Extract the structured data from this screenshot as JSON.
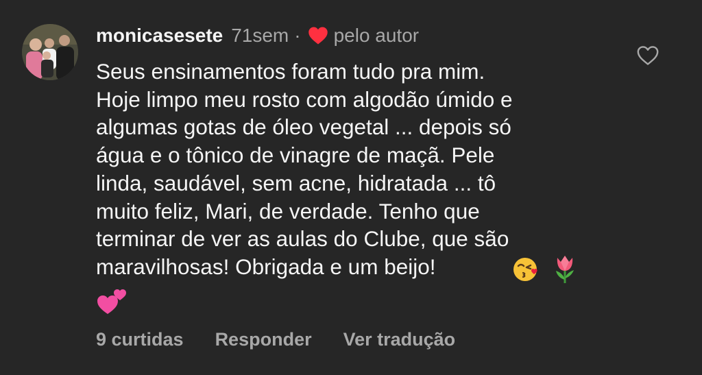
{
  "comment": {
    "username": "monicasesete",
    "time_ago": "71sem",
    "separator": "·",
    "author_badge": "pelo autor",
    "text": "Seus ensinamentos foram tudo pra mim.\nHoje limpo meu rosto com algodão úmido e\nalgumas gotas de óleo vegetal ... depois só\nágua e o tônico de vinagre de maçã. Pele\nlinda, saudável,  sem acne, hidratada ... tô\nmuito feliz, Mari, de verdade. Tenho que\nterminar de ver as aulas do Clube, que são\nmaravilhosas! Obrigada e um beijo!",
    "emojis": [
      "kissing-face-with-heart",
      "tulip",
      "two-hearts"
    ]
  },
  "footer": {
    "likes": "9 curtidas",
    "reply": "Responder",
    "translate": "Ver tradução"
  },
  "icons": {
    "like": "heart-outline-icon",
    "author_heart": "heart-filled-icon"
  },
  "colors": {
    "background": "#262626",
    "text": "#f5f5f5",
    "secondary": "#a8a8a8",
    "heart": "#ff3040"
  }
}
